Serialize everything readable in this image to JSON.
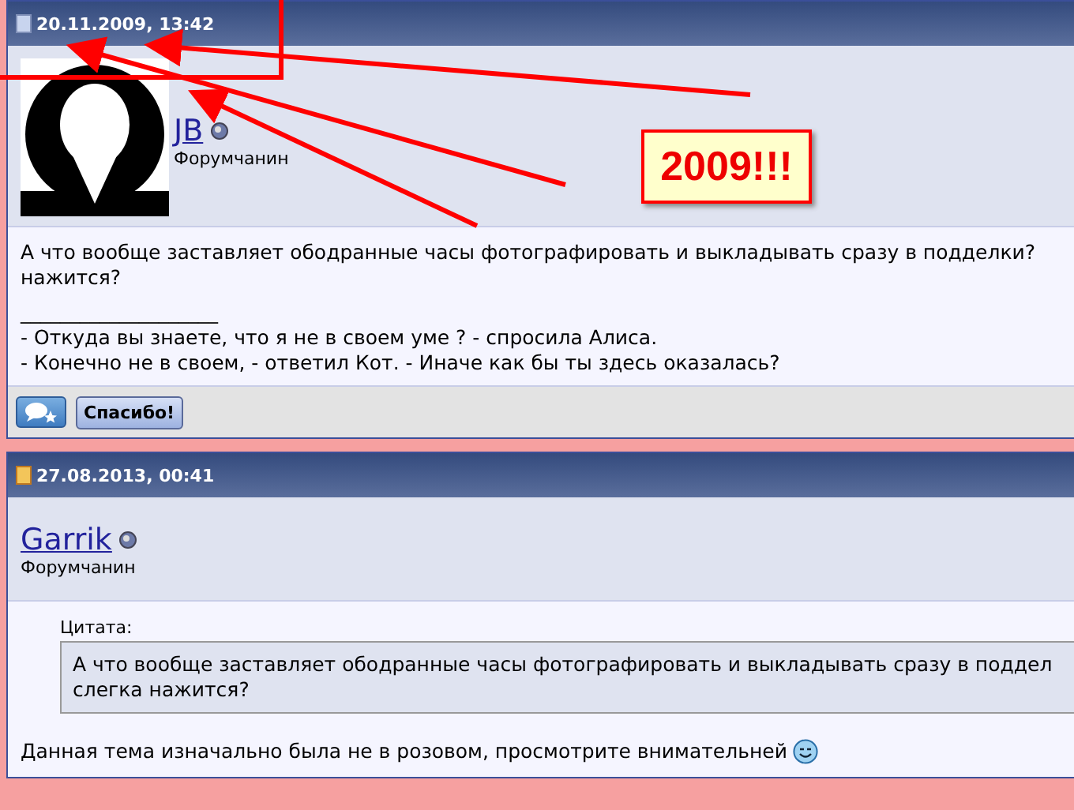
{
  "posts": [
    {
      "date": "20.11.2009, 13:42",
      "unread": false,
      "has_avatar": true,
      "username": "JB",
      "rank": "Форумчанин",
      "online": false,
      "message_lines": [
        "А что вообще заставляет ободранные часы фотографировать и выкладывать сразу в подделки?",
        "нажится?"
      ],
      "signature": [
        "____________________",
        "- Откуда вы знаете, что я не в своем уме ? - спросила Алиса.",
        "- Конечно не в своем, - ответил Кот. - Иначе как бы ты здесь оказалась?"
      ],
      "thanks_button": "Спасибо!"
    },
    {
      "date": "27.08.2013, 00:41",
      "unread": true,
      "has_avatar": false,
      "username": "Garrik",
      "rank": "Форумчанин",
      "online": false,
      "quote": {
        "label": "Цитата:",
        "lines": [
          "А что вообще заставляет ободранные часы фотографировать и выкладывать сразу в поддел",
          "слегка нажится?"
        ]
      },
      "message_lines": [
        "Данная тема изначально была не в розовом, просмотрите внимательней"
      ],
      "smiley": true
    }
  ],
  "annotation": {
    "label": "2009!!!"
  }
}
